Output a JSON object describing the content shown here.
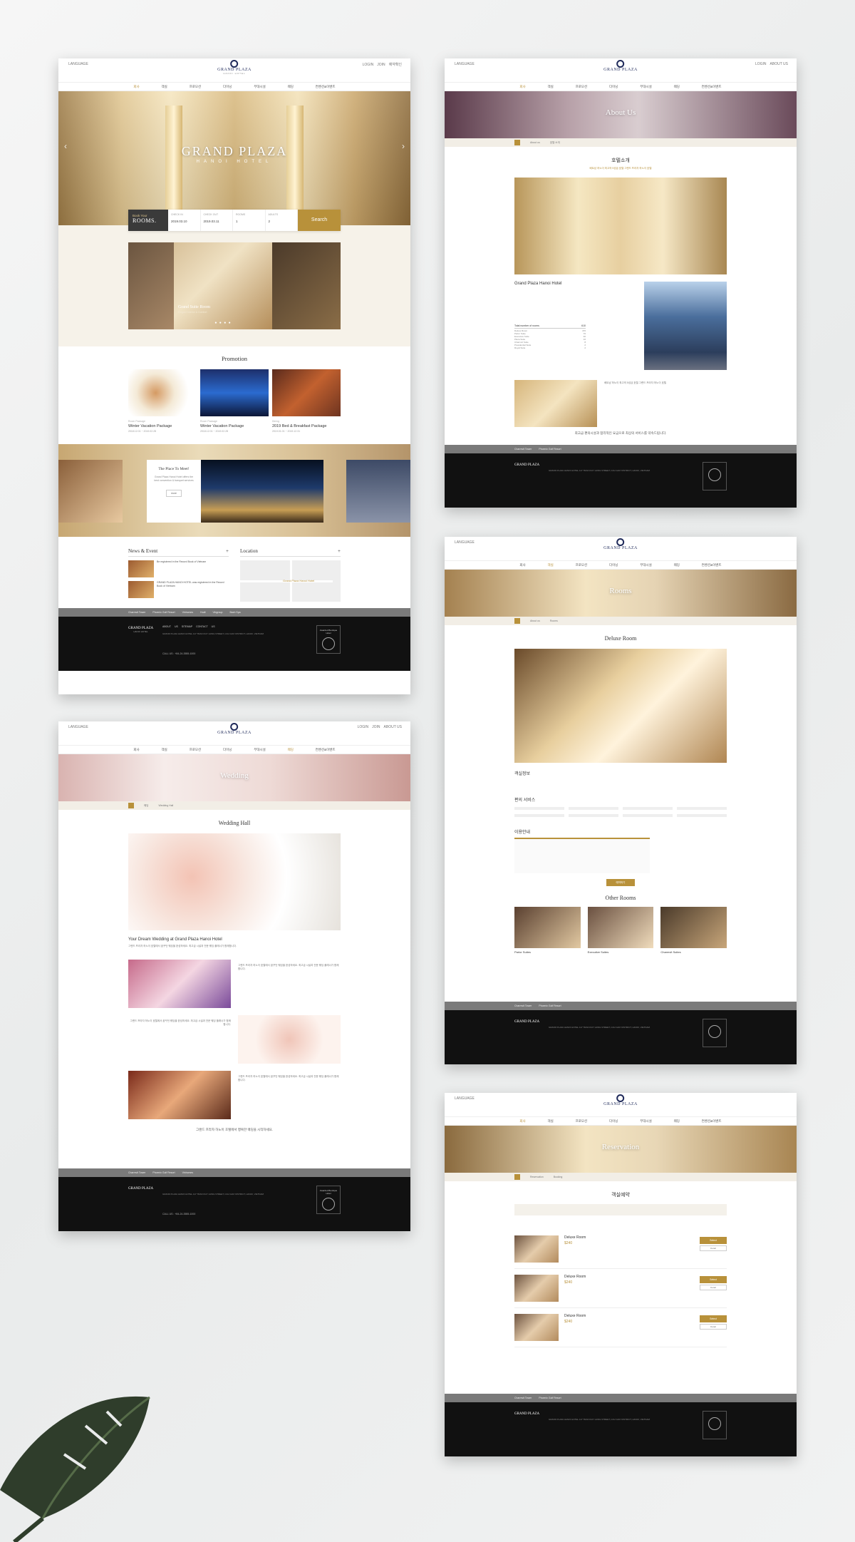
{
  "common": {
    "language": "LANGUAGE",
    "utils": [
      "LOGIN",
      "JOIN",
      "예약확인",
      "ABOUT US"
    ],
    "logo_name": "GRAND PLAZA",
    "logo_sub": "HANOI HOTEL",
    "nav": [
      "회사",
      "객실",
      "프로모션",
      "다이닝",
      "부대시설",
      "웨딩",
      "컨벤션&이벤트"
    ],
    "footer_links": [
      "Charmvit Tower",
      "Phoenix Golf Resort",
      "Vinhomes",
      "Hudt",
      "Vingroup",
      "Bach Spa"
    ],
    "footer_menu": [
      "ABOUT US",
      "약관 및 개인정보",
      "이용약관",
      "VOICE OF CUSTOMER",
      "SITEMAP",
      "채용",
      "CONTACT US"
    ],
    "footer_address": "GRAND PLAZA HANOI HOTEL 117 TRAN DUY HUNG STREET, CAU GIAY DISTRICT, HANOI, VIETNAM",
    "footer_call": "CALL US : +84-24-3555-1000",
    "footer_badge": "Awarded Boutique Hotel",
    "family_site": "Family Site"
  },
  "home": {
    "hero_title": "GRAND PLAZA",
    "hero_sub": "HANOI HOTEL",
    "booking_label": "Book Your",
    "booking_rooms": "ROOMS.",
    "booking_fields": [
      {
        "label": "CHECK IN",
        "value": "2019.03.10"
      },
      {
        "label": "CHECK OUT",
        "value": "2019.03.11"
      },
      {
        "label": "ROOMS",
        "value": "1"
      },
      {
        "label": "ADULTS",
        "value": "2"
      }
    ],
    "booking_search": "Search",
    "slider_caption": "Grand Suite Room",
    "slider_caption_sub": "Elegant Interior & Comfort",
    "slider_dots": "● ● ● ●",
    "promotion_title": "Promotion",
    "promotions": [
      {
        "cat": "Room Package",
        "name": "Winter Vacation Package",
        "date": "2018.12.01 ~ 2019.02.28"
      },
      {
        "cat": "Room Package",
        "name": "Winter Vacation Package",
        "date": "2018.12.01 ~ 2019.02.28"
      },
      {
        "cat": "Dining",
        "name": "2019 Bed & Breakfast Package",
        "date": "2019.01.01 ~ 2019.12.31"
      }
    ],
    "place_title": "The Place To Meet!",
    "place_desc": "Grand Plaza Hanoi Hotel offers the best convention & banquet services",
    "place_btn": "more",
    "news_title": "News & Event",
    "news_items": [
      "Be registered in the Record Book of Vietnam",
      "GRAND PLAZA HANOI HOTEL was registered in the Record Book of Vietnam"
    ],
    "location_title": "Location",
    "map_pin": "Grand Plaza Hanoi Hotel"
  },
  "wedding": {
    "hero_title": "Wedding",
    "crumb": [
      "웨딩",
      "Wedding Hall"
    ],
    "heading": "Wedding Hall",
    "subtitle": "Your Dream Wedding at Grand Plaza Hanoi Hotel",
    "text": "그랜드 프라자 하노이 호텔에서 꿈꾸던 웨딩을 완성하세요. 최고급 시설과 전문 웨딩 플래너가 함께합니다.",
    "closing": "그랜드 프라자 하노이 호텔에서 행복한 웨딩을 시작하세요."
  },
  "about": {
    "hero_title": "About Us",
    "crumb": [
      "About us",
      "호텔 소개"
    ],
    "heading": "호텔소개",
    "lead": "베트남 하노이 최고의 5성급 호텔 그랜드 프라자 하노이 호텔",
    "subtitle": "Grand Plaza Hanoi Hotel",
    "rooms_label": "Total number of rooms",
    "rooms_total": "610",
    "room_rows": [
      {
        "type": "Deluxe Room",
        "count": "476"
      },
      {
        "type": "Parlor Suite",
        "count": "76"
      },
      {
        "type": "Executive Suite",
        "count": "30"
      },
      {
        "type": "Plaza Suite",
        "count": "16"
      },
      {
        "type": "Charmvit Suite",
        "count": "8"
      },
      {
        "type": "Presidential Suite",
        "count": "2"
      },
      {
        "type": "Royal Suite",
        "count": "2"
      }
    ],
    "closing": "최고급 편의시설과 합리적인 요금으로 최상의 서비스를 약속드립니다."
  },
  "rooms": {
    "hero_title": "Rooms",
    "crumb": [
      "About us",
      "Rooms"
    ],
    "heading": "Deluxe Room",
    "info_title": "객실정보",
    "service_title": "편의 서비스",
    "guide_title": "이용안내",
    "reserve_btn": "예약하기",
    "other_title": "Other Rooms",
    "others": [
      "Parlor Suites",
      "Executive Suites",
      "Charmvit Suites"
    ],
    "detail": "Detail"
  },
  "reservation": {
    "hero_title": "Reservation",
    "crumb": [
      "Reservation",
      "Booking"
    ],
    "heading": "객실예약",
    "rooms": [
      {
        "name": "Deluxe Room",
        "price": "$240"
      },
      {
        "name": "Deluxe Room",
        "price": "$240"
      },
      {
        "name": "Deluxe Room",
        "price": "$240"
      }
    ],
    "select_label": "Select",
    "detail_label": "Detail"
  },
  "colors": {
    "gold": "#b8913a",
    "navy": "#1f2a5a",
    "footer": "#111111"
  }
}
